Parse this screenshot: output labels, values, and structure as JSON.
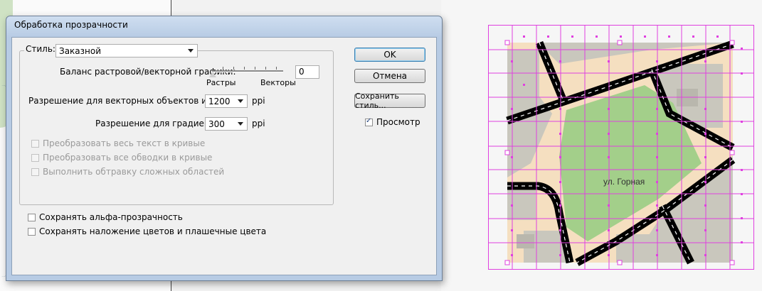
{
  "dialog": {
    "title": "Обработка прозрачности",
    "style_label": "Стиль:",
    "style_value": "Заказной",
    "balance_label": "Баланс растровой/векторной графики:",
    "balance_value": "0",
    "slider_left": "Растры",
    "slider_right": "Векторы",
    "vector_res_label": "Разрешение для векторных объектов и текста:",
    "vector_res_value": "1200",
    "vector_res_unit": "ppi",
    "gradient_res_label": "Разрешение для градиентов:",
    "gradient_res_value": "300",
    "gradient_res_unit": "ppi",
    "opt_text_curves": "Преобразовать весь текст в кривые",
    "opt_strokes_curves": "Преобразовать все обводки в кривые",
    "opt_clip_complex": "Выполнить обтравку сложных областей",
    "opt_alpha": "Сохранять альфа-прозрачность",
    "opt_overprint": "Сохранять наложение цветов и плашечные цвета",
    "btn_ok": "OK",
    "btn_cancel": "Отмена",
    "btn_save_style": "Сохранить стиль...",
    "preview_label": "Просмотр",
    "preview_checked": true
  },
  "map": {
    "street_label": "ул. Горная"
  },
  "colors": {
    "grid": "#e040e0",
    "park": "#a3cf8a",
    "building": "#c9c7bd",
    "sand": "#f5dfc0",
    "road": "#000000"
  }
}
